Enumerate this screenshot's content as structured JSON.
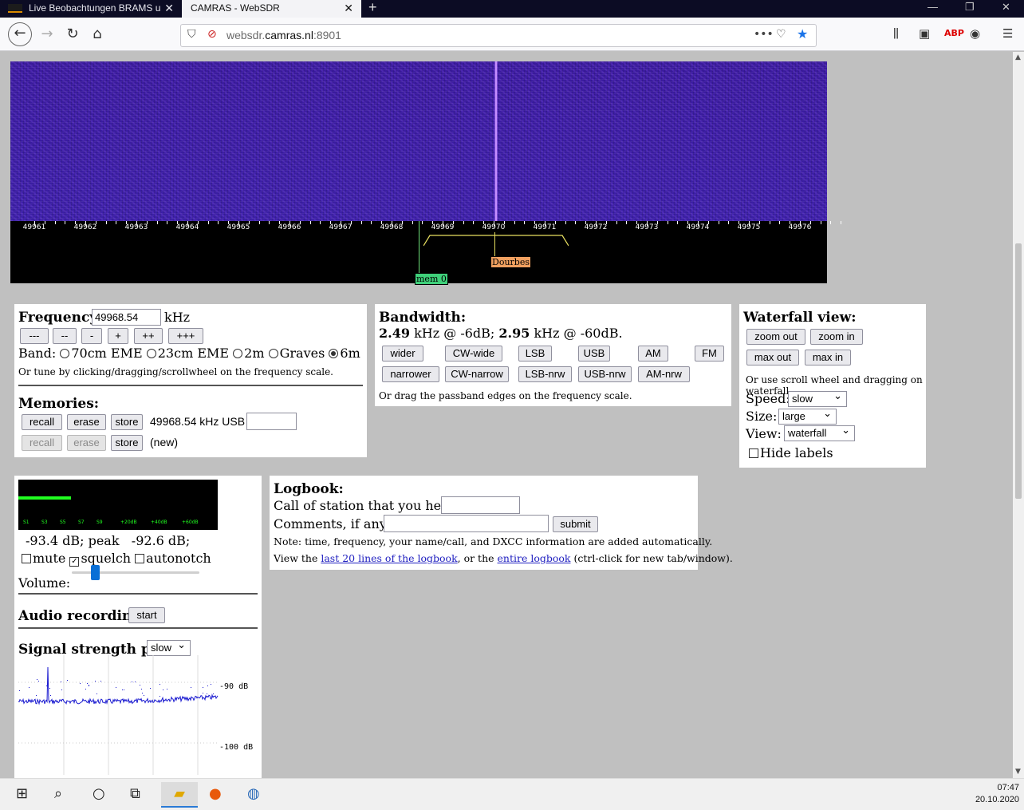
{
  "browser": {
    "tabs": [
      {
        "label": "Live Beobachtungen BRAMS u",
        "close": "✕"
      },
      {
        "label": "CAMRAS - WebSDR",
        "close": "✕"
      }
    ],
    "new_tab": "+",
    "window_buttons": {
      "minimize": "—",
      "maximize": "❐",
      "close": "✕"
    },
    "url_prefix": "websdr.",
    "url_host": "camras.nl",
    "url_suffix": ":8901",
    "url_actions": "•••"
  },
  "waterfall": {
    "freq_labels": [
      "49961",
      "49962",
      "49963",
      "49964",
      "49965",
      "49966",
      "49967",
      "49968",
      "49969",
      "49970",
      "49971",
      "49972",
      "49973",
      "49974",
      "49975",
      "49976"
    ],
    "markers": {
      "memory": "mem 0",
      "station": "Dourbes"
    }
  },
  "frequency": {
    "title": "Frequency:",
    "value": "49968.54",
    "unit": "kHz",
    "step_buttons": [
      "---",
      "--",
      "-",
      "+",
      "++",
      "+++"
    ],
    "band_label": "Band:",
    "bands": [
      "70cm EME",
      "23cm EME",
      "2m",
      "Graves",
      "6m"
    ],
    "selected_band": "6m",
    "hint": "Or tune by clicking/dragging/scrollwheel on the frequency scale."
  },
  "memories": {
    "title": "Memories:",
    "row1": {
      "recall": "recall",
      "erase": "erase",
      "store": "store",
      "info": "49968.54 kHz USB"
    },
    "row2": {
      "recall": "recall",
      "erase": "erase",
      "store": "store",
      "info": "(new)"
    }
  },
  "bandwidth": {
    "title": "Bandwidth:",
    "bw6_value": "2.49",
    "bw6_text": "kHz @ -6dB;",
    "bw60_value": "2.95",
    "bw60_text": "kHz @ -60dB.",
    "row1": [
      "wider",
      "CW-wide",
      "LSB",
      "USB",
      "AM",
      "FM"
    ],
    "row2": [
      "narrower",
      "CW-narrow",
      "LSB-nrw",
      "USB-nrw",
      "AM-nrw"
    ],
    "hint": "Or drag the passband edges on the frequency scale."
  },
  "waterfall_view": {
    "title": "Waterfall view:",
    "zoom_out": "zoom out",
    "zoom_in": "zoom in",
    "max_out": "max out",
    "max_in": "max in",
    "hint": "Or use scroll wheel and dragging on waterfall.",
    "speed_label": "Speed:",
    "speed": "slow",
    "size_label": "Size:",
    "size": "large",
    "view_label": "View:",
    "view": "waterfall",
    "hide_labels": "Hide labels"
  },
  "signal": {
    "smeter_labels": [
      "S1",
      "S3",
      "S5",
      "S7",
      "S9",
      "+20dB",
      "+40dB",
      "+60dB"
    ],
    "readout": "-93.4 dB; peak   -92.6 dB;",
    "mute": "mute",
    "squelch": "squelch",
    "autonotch": "autonotch",
    "volume_label": "Volume:",
    "volume_level": 0.15,
    "recording_title": "Audio recording:",
    "recording_button": "start",
    "plot_title": "Signal strength plot:",
    "plot_speed": "slow",
    "plot_top_label": "-90 dB",
    "plot_bottom_label": "-100 dB"
  },
  "logbook": {
    "title": "Logbook:",
    "call_label": "Call of station that you hear:",
    "comments_label": "Comments, if any:",
    "submit": "submit",
    "note": "Note: time, frequency, your name/call, and DXCC information are added automatically.",
    "view_prefix": "View the",
    "link1": "last 20 lines of the logbook",
    "view_middle": ", or the",
    "link2": "entire logbook",
    "view_suffix": "(ctrl-click for new tab/window)."
  },
  "taskbar": {
    "time": "07:47",
    "date": "20.10.2020"
  },
  "colors": {
    "waterfall": "#3a1a9e",
    "smeter": "#20ff20",
    "mem_marker": "#3fd07a",
    "station_marker": "#f0a060",
    "link": "#2020c0"
  }
}
